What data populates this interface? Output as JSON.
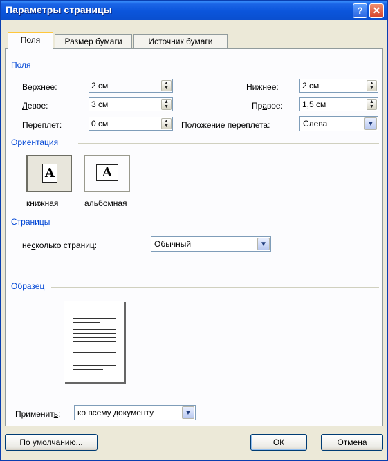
{
  "window": {
    "title": "Параметры страницы",
    "help_glyph": "?",
    "close_glyph": "✕"
  },
  "tabs": [
    {
      "label": "Поля"
    },
    {
      "label": "Размер бумаги"
    },
    {
      "label": "Источник бумаги"
    }
  ],
  "margins": {
    "group_label": "Поля",
    "top": {
      "label": "Верхнее:",
      "value": "2 см"
    },
    "bottom": {
      "label": "Нижнее:",
      "value": "2 см"
    },
    "left": {
      "label": "Левое:",
      "value": "3 см"
    },
    "right": {
      "label": "Правое:",
      "value": "1,5 см"
    },
    "gutter": {
      "label": "Переплет:",
      "value": "0 см"
    },
    "gutter_position": {
      "label": "Положение переплета:",
      "value": "Слева"
    }
  },
  "orientation": {
    "group_label": "Ориентация",
    "portrait_label": "книжная",
    "landscape_label": "альбомная",
    "selected": "portrait",
    "paper_glyph": "A"
  },
  "pages": {
    "group_label": "Страницы",
    "multiple_label": "несколько страниц:",
    "multiple_value": "Обычный"
  },
  "preview": {
    "group_label": "Образец"
  },
  "apply": {
    "label": "Применить:",
    "value": "ко всему документу"
  },
  "buttons": {
    "default_label": "По умолчанию...",
    "ok_label": "ОК",
    "cancel_label": "Отмена"
  },
  "icons": {
    "spin": "spin-arrows-icon",
    "dropdown": "chevron-down-icon"
  }
}
